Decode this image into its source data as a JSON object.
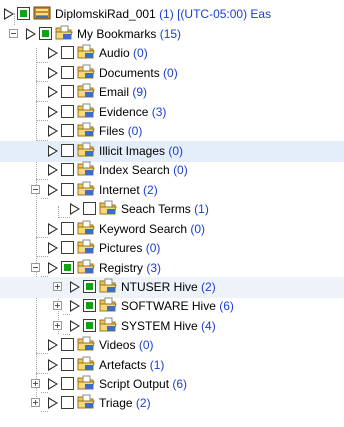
{
  "tree": {
    "root": {
      "name": "DiplomskiRad_001",
      "count": "(1)",
      "timezone": "[(UTC-05:00) Eas"
    },
    "bookmarks": {
      "name": "My Bookmarks",
      "count": "(15)"
    },
    "items": [
      {
        "name": "Audio",
        "count": "(0)"
      },
      {
        "name": "Documents",
        "count": "(0)"
      },
      {
        "name": "Email",
        "count": "(9)"
      },
      {
        "name": "Evidence",
        "count": "(3)"
      },
      {
        "name": "Files",
        "count": "(0)"
      },
      {
        "name": "Illicit Images",
        "count": "(0)",
        "selected": true
      },
      {
        "name": "Index Search",
        "count": "(0)"
      },
      {
        "name": "Internet",
        "count": "(2)"
      },
      {
        "name": "Seach Terms",
        "count": "(1)"
      },
      {
        "name": "Keyword Search",
        "count": "(0)"
      },
      {
        "name": "Pictures",
        "count": "(0)"
      },
      {
        "name": "Registry",
        "count": "(3)"
      },
      {
        "name": "NTUSER Hive",
        "count": "(2)"
      },
      {
        "name": "SOFTWARE Hive",
        "count": "(6)"
      },
      {
        "name": "SYSTEM Hive",
        "count": "(4)"
      },
      {
        "name": "Videos",
        "count": "(0)"
      },
      {
        "name": "Artefacts",
        "count": "(1)"
      },
      {
        "name": "Script Output",
        "count": "(6)"
      },
      {
        "name": "Triage",
        "count": "(2)"
      }
    ]
  },
  "colors": {
    "count": "#1b3fd1",
    "highlight": "#e3eefa",
    "check": "#12a312"
  }
}
